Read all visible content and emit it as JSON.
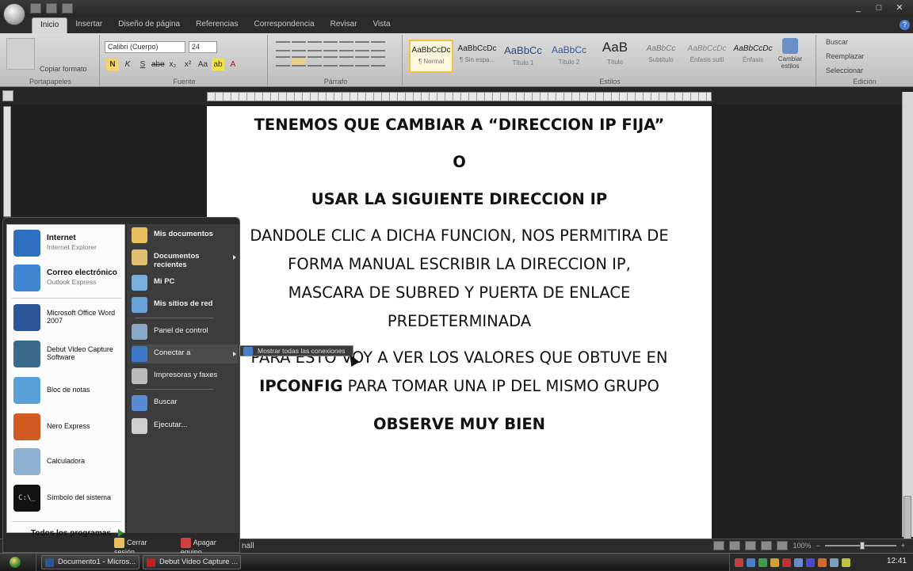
{
  "tabs": [
    "Inicio",
    "Insertar",
    "Diseño de página",
    "Referencias",
    "Correspondencia",
    "Revisar",
    "Vista"
  ],
  "ribbon": {
    "clipboard": {
      "label": "Portapapeles",
      "copy_format": "Copiar formato"
    },
    "font": {
      "label": "Fuente",
      "family": "Calibri (Cuerpo)",
      "size": "24",
      "buttons": [
        "N",
        "K",
        "S",
        "abe",
        "x₂",
        "x²",
        "Aa",
        "ab",
        "A"
      ]
    },
    "paragraph": {
      "label": "Párrafo"
    },
    "styles": {
      "label": "Estilos",
      "tiles": [
        {
          "sample": "AaBbCcDc",
          "name": "¶ Normal"
        },
        {
          "sample": "AaBbCcDc",
          "name": "¶ Sin espa..."
        },
        {
          "sample": "AaBbCc",
          "name": "Título 1"
        },
        {
          "sample": "AaBbCc",
          "name": "Título 2"
        },
        {
          "sample": "AaB",
          "name": "Título"
        },
        {
          "sample": "AaBbCc",
          "name": "Subtítulo"
        },
        {
          "sample": "AaBbCcDc",
          "name": "Énfasis sutil"
        },
        {
          "sample": "AaBbCcDc",
          "name": "Énfasis"
        }
      ],
      "change_styles": "Cambiar estilos"
    },
    "editing": {
      "label": "Edición",
      "find": "Buscar",
      "replace": "Reemplazar",
      "select": "Seleccionar"
    }
  },
  "document": {
    "line1": "TENEMOS QUE CAMBIAR A “DIRECCION IP FIJA”",
    "line2": "O",
    "line3": "USAR LA SIGUIENTE DIRECCION IP",
    "para1": [
      "DANDOLE CLIC A DICHA FUNCION, NOS PERMITIRA DE",
      "FORMA MANUAL ESCRIBIR LA DIRECCION IP,",
      "MASCARA DE SUBRED Y PUERTA DE ENLACE",
      "PREDETERMINADA"
    ],
    "para2_line1": "PARA ESTO VOY A VER LOS VALORES QUE OBTUVE EN",
    "para2_bold": "IPCONFIG",
    "para2_rest": " PARA TOMAR UNA IP DEL MISMO GRUPO",
    "line_last": "OBSERVE MUY BIEN"
  },
  "start_menu": {
    "pinned": [
      {
        "title": "Internet",
        "sub": "Internet Explorer",
        "icon": "internet-explorer-icon",
        "color": "#2f6fc0"
      },
      {
        "title": "Correo electrónico",
        "sub": "Outlook Express",
        "icon": "outlook-express-icon",
        "color": "#3f85cf"
      }
    ],
    "recent": [
      {
        "title": "Microsoft Office Word 2007",
        "icon": "word-icon",
        "color": "#2b579a"
      },
      {
        "title": "Debut Video Capture Software",
        "icon": "debut-icon",
        "color": "#3a6a8a"
      },
      {
        "title": "Bloc de notas",
        "icon": "notepad-icon",
        "color": "#5aa0d8"
      },
      {
        "title": "Nero Express",
        "icon": "nero-icon",
        "color": "#d05a20"
      },
      {
        "title": "Calculadora",
        "icon": "calculator-icon",
        "color": "#8fb0d0"
      },
      {
        "title": "Símbolo del sistema",
        "icon": "cmd-icon",
        "color": "#111111"
      }
    ],
    "all_programs": "Todos los programas",
    "right": [
      {
        "label": "Mis documentos",
        "icon": "folder-icon",
        "color": "#e8c060",
        "bold": true
      },
      {
        "label": "Documentos recientes",
        "icon": "recent-docs-icon",
        "color": "#e0c070",
        "bold": true
      },
      {
        "label": "Mi PC",
        "icon": "computer-icon",
        "color": "#7ab0e0",
        "bold": true
      },
      {
        "label": "Mis sitios de red",
        "icon": "network-icon",
        "color": "#6aa0d8",
        "bold": true
      },
      {
        "label": "Panel de control",
        "icon": "control-panel-icon",
        "color": "#8aa8c8",
        "bold": false
      },
      {
        "label": "Conectar a",
        "icon": "connect-icon",
        "color": "#3a78c8",
        "bold": false
      },
      {
        "label": "Impresoras y faxes",
        "icon": "printer-icon",
        "color": "#bbbbbb",
        "bold": false
      },
      {
        "label": "Buscar",
        "icon": "search-icon",
        "color": "#5a8ad0",
        "bold": false
      },
      {
        "label": "Ejecutar...",
        "icon": "run-icon",
        "color": "#cfcfcf",
        "bold": false
      }
    ],
    "logoff": "Cerrar sesión",
    "shutdown": "Apagar equipo",
    "submenu": "Mostrar todas las conexiones"
  },
  "status": {
    "left": "nall",
    "zoom": "100%"
  },
  "taskbar": {
    "buttons": [
      "Documento1 - Micros...",
      "Debut Video Capture ..."
    ],
    "clock": "12:41"
  }
}
